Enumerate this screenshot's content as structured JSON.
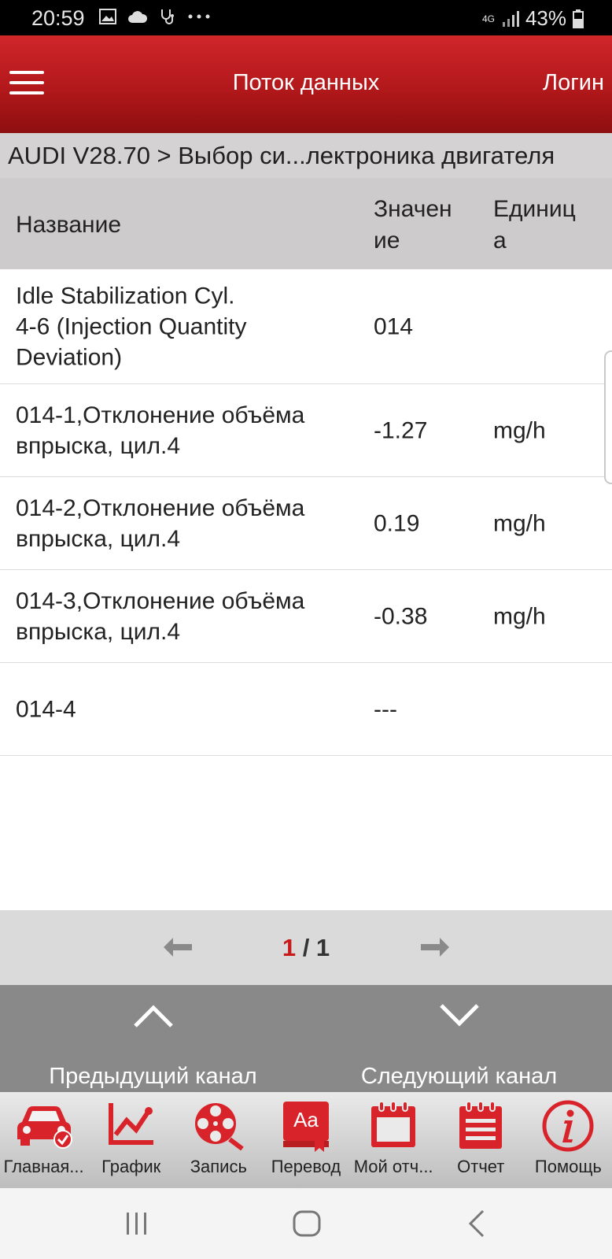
{
  "status_bar": {
    "time": "20:59",
    "network": "4G",
    "battery": "43%"
  },
  "header": {
    "title": "Поток данных",
    "login": "Логин"
  },
  "breadcrumb": "AUDI V28.70 > Выбор си...лектроника двигателя",
  "table": {
    "columns": {
      "name": "Название",
      "value": "Значен\nие",
      "unit": "Единиц\nа"
    },
    "rows": [
      {
        "name": "Idle Stabilization Cyl.\n4-6 (Injection Quantity\nDeviation)",
        "value": "014",
        "unit": ""
      },
      {
        "name": "014-1,Отклонение объёма\nвпрыска, цил.4",
        "value": "-1.27",
        "unit": "mg/h"
      },
      {
        "name": "014-2,Отклонение объёма\nвпрыска, цил.4",
        "value": "0.19",
        "unit": "mg/h"
      },
      {
        "name": "014-3,Отклонение объёма\nвпрыска, цил.4",
        "value": "-0.38",
        "unit": "mg/h"
      },
      {
        "name": "014-4",
        "value": "---",
        "unit": ""
      }
    ]
  },
  "pager": {
    "current": "1",
    "total": "/ 1"
  },
  "channel_nav": {
    "prev_label": "Предыдущий канал",
    "next_label": "Следующий канал"
  },
  "toolbar": [
    {
      "label": "Главная...",
      "icon": "car-check-icon"
    },
    {
      "label": "График",
      "icon": "chart-icon"
    },
    {
      "label": "Запись",
      "icon": "film-reel-icon"
    },
    {
      "label": "Перевод",
      "icon": "translate-icon"
    },
    {
      "label": "Мой отч...",
      "icon": "calendar-icon"
    },
    {
      "label": "Отчет",
      "icon": "report-icon"
    },
    {
      "label": "Помощь",
      "icon": "info-icon"
    }
  ],
  "colors": {
    "accent": "#c8191d",
    "header_dark": "#8e0f10",
    "icon_red": "#d8232a"
  }
}
